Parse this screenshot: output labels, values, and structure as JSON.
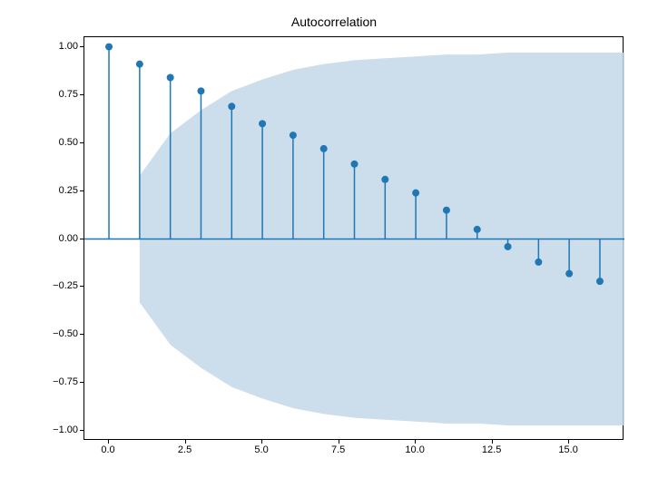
{
  "chart_data": {
    "type": "stem",
    "title": "Autocorrelation",
    "xlabel": "",
    "ylabel": "",
    "x": [
      0,
      1,
      2,
      3,
      4,
      5,
      6,
      7,
      8,
      9,
      10,
      11,
      12,
      13,
      14,
      15,
      16
    ],
    "values": [
      1.0,
      0.91,
      0.84,
      0.77,
      0.69,
      0.6,
      0.54,
      0.47,
      0.39,
      0.31,
      0.24,
      0.15,
      0.05,
      -0.04,
      -0.12,
      -0.18,
      -0.22
    ],
    "confidence_band": {
      "x": [
        1,
        2,
        3,
        4,
        5,
        6,
        7,
        8,
        9,
        10,
        11,
        12,
        13,
        14,
        15,
        16
      ],
      "upper": [
        0.33,
        0.55,
        0.67,
        0.77,
        0.83,
        0.88,
        0.91,
        0.93,
        0.94,
        0.95,
        0.96,
        0.96,
        0.97,
        0.97,
        0.97,
        0.97
      ],
      "lower": [
        -0.33,
        -0.55,
        -0.67,
        -0.77,
        -0.83,
        -0.88,
        -0.91,
        -0.93,
        -0.94,
        -0.95,
        -0.96,
        -0.96,
        -0.97,
        -0.97,
        -0.97,
        -0.97
      ]
    },
    "xlim": [
      -0.8,
      16.8
    ],
    "ylim": [
      -1.05,
      1.05
    ],
    "x_ticks": [
      0.0,
      2.5,
      5.0,
      7.5,
      10.0,
      12.5,
      15.0
    ],
    "x_tick_labels": [
      "0.0",
      "2.5",
      "5.0",
      "7.5",
      "10.0",
      "12.5",
      "15.0"
    ],
    "y_ticks": [
      -1.0,
      -0.75,
      -0.5,
      -0.25,
      0.0,
      0.25,
      0.5,
      0.75,
      1.0
    ],
    "y_tick_labels": [
      "−1.00",
      "−0.75",
      "−0.50",
      "−0.25",
      "0.00",
      "0.25",
      "0.50",
      "0.75",
      "1.00"
    ],
    "colors": {
      "stem": "#1f77b4",
      "marker": "#1f77b4",
      "band": "#c3d7e9",
      "zero_line": "#1f77b4"
    }
  }
}
